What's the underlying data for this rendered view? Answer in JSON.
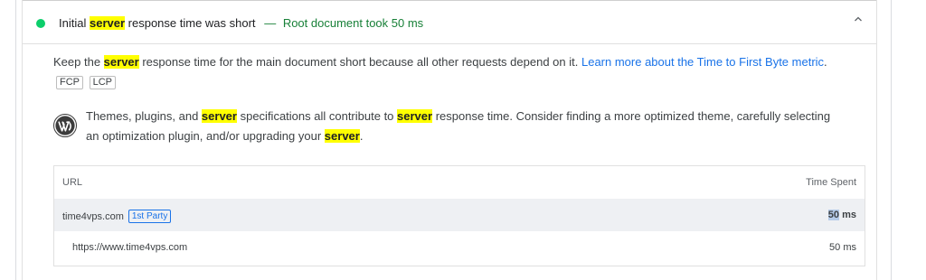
{
  "audit": {
    "title_prefix": "Initial",
    "title_highlight": "server",
    "title_suffix": "response time was short",
    "dash": "—",
    "display_value": "Root document took 50 ms",
    "status_color": "#0cce6b"
  },
  "description": {
    "text_before": "Keep the",
    "highlight": "server",
    "text_after": "response time for the main document short because all other requests depend on it.",
    "link_text": "Learn more about the Time to First Byte metric",
    "period": ".",
    "tags": [
      "FCP",
      "LCP"
    ]
  },
  "stack_pack": {
    "icon": "wordpress-icon",
    "part1": "Themes, plugins, and",
    "hl1": "server",
    "part2": "specifications all contribute to",
    "hl2": "server",
    "part3": "response time. Consider finding a more optimized theme, carefully selecting an optimization plugin, and/or upgrading your",
    "hl3": "server",
    "part4": "."
  },
  "table": {
    "headers": {
      "url": "URL",
      "time": "Time Spent"
    },
    "group_row": {
      "entity": "time4vps.com",
      "badge": "1st Party",
      "time_value": "50",
      "time_unit": "ms"
    },
    "sub_rows": [
      {
        "url": "https://www.time4vps.com",
        "time": "50 ms"
      }
    ]
  }
}
